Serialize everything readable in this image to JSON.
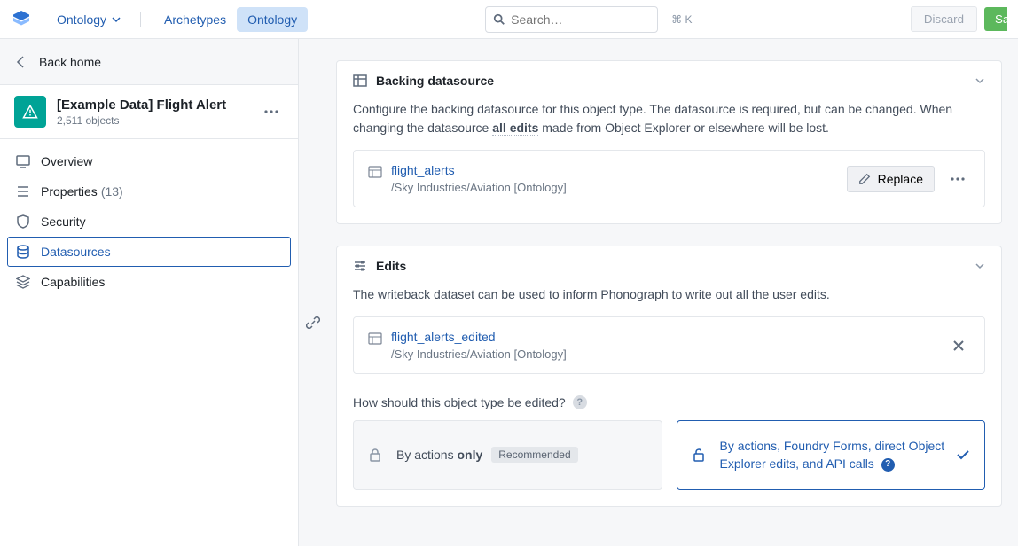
{
  "topbar": {
    "nav_label": "Ontology",
    "tabs": {
      "archetypes": "Archetypes",
      "ontology": "Ontology"
    },
    "search_placeholder": "Search…",
    "search_kbd": "⌘ K",
    "discard": "Discard",
    "save": "Save"
  },
  "sidebar": {
    "back_label": "Back home",
    "entity": {
      "title": "[Example Data] Flight Alert",
      "sub": "2,511 objects"
    },
    "nav": {
      "overview": "Overview",
      "properties": "Properties",
      "properties_count": "(13)",
      "security": "Security",
      "datasources": "Datasources",
      "capabilities": "Capabilities"
    }
  },
  "panels": {
    "backing": {
      "title": "Backing datasource",
      "desc_pre": "Configure the backing datasource for this object type. The datasource is required, but can be changed. When changing the datasource ",
      "desc_bold": "all edits",
      "desc_post": " made from Object Explorer or elsewhere will be lost.",
      "ds_name": "flight_alerts",
      "ds_path": "/Sky Industries/Aviation [Ontology]",
      "replace": "Replace"
    },
    "edits": {
      "title": "Edits",
      "desc": "The writeback dataset can be used to inform Phonograph to write out all the user edits.",
      "ds_name": "flight_alerts_edited",
      "ds_path": "/Sky Industries/Aviation [Ontology]",
      "question": "How should this object type be edited?",
      "opt1_pre": "By actions ",
      "opt1_bold": "only",
      "opt1_badge": "Recommended",
      "opt2": "By actions, Foundry Forms, direct Object Explorer edits, and API calls"
    }
  }
}
